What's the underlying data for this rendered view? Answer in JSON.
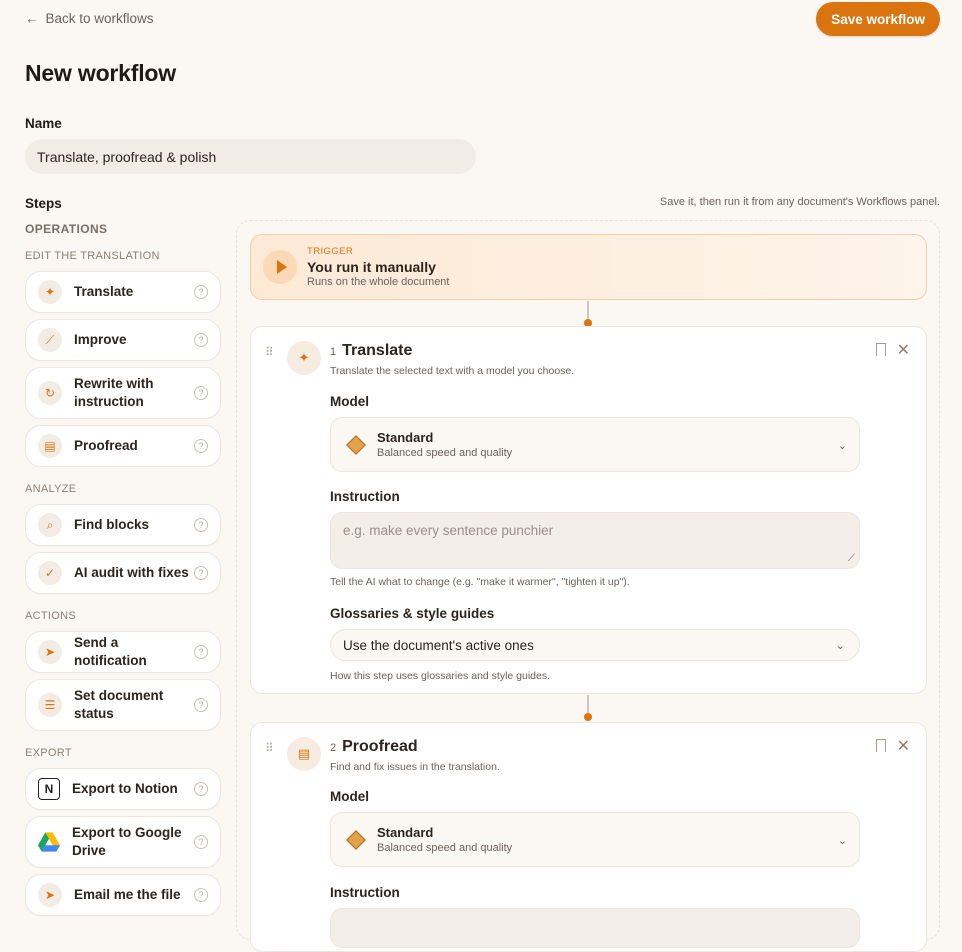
{
  "topbar": {
    "back_label": "Back to workflows",
    "save_label": "Save workflow"
  },
  "page": {
    "title": "New workflow"
  },
  "name_field": {
    "label": "Name",
    "value": "Translate, proofread & polish"
  },
  "steps": {
    "label": "Steps",
    "hint": "Save it, then run it from any document's Workflows panel."
  },
  "sidebar": {
    "operations_title": "OPERATIONS",
    "groups": [
      {
        "title": "EDIT THE TRANSLATION",
        "items": [
          "Translate",
          "Improve",
          "Rewrite with instruction",
          "Proofread"
        ]
      },
      {
        "title": "ANALYZE",
        "items": [
          "Find blocks",
          "AI audit with fixes"
        ]
      },
      {
        "title": "ACTIONS",
        "items": [
          "Send a notification",
          "Set document status"
        ]
      },
      {
        "title": "EXPORT",
        "items": [
          "Export to Notion",
          "Export to Google Drive",
          "Email me the file"
        ]
      }
    ]
  },
  "trigger": {
    "tag": "TRIGGER",
    "title": "You run it manually",
    "subtitle": "Runs on the whole document"
  },
  "step1": {
    "number": "1",
    "title": "Translate",
    "description": "Translate the selected text with a model you choose.",
    "model_label": "Model",
    "model_name": "Standard",
    "model_sub": "Balanced speed and quality",
    "instruction_label": "Instruction",
    "instruction_placeholder": "e.g. make every sentence punchier",
    "instruction_help": "Tell the AI what to change (e.g. \"make it warmer\", \"tighten it up\").",
    "glossary_label": "Glossaries & style guides",
    "glossary_value": "Use the document's active ones",
    "glossary_help": "How this step uses glossaries and style guides."
  },
  "step2": {
    "number": "2",
    "title": "Proofread",
    "description": "Find and fix issues in the translation.",
    "model_label": "Model",
    "model_name": "Standard",
    "model_sub": "Balanced speed and quality",
    "instruction_label": "Instruction"
  },
  "colors": {
    "accent": "#d9740f",
    "background": "#fbf8f3"
  }
}
